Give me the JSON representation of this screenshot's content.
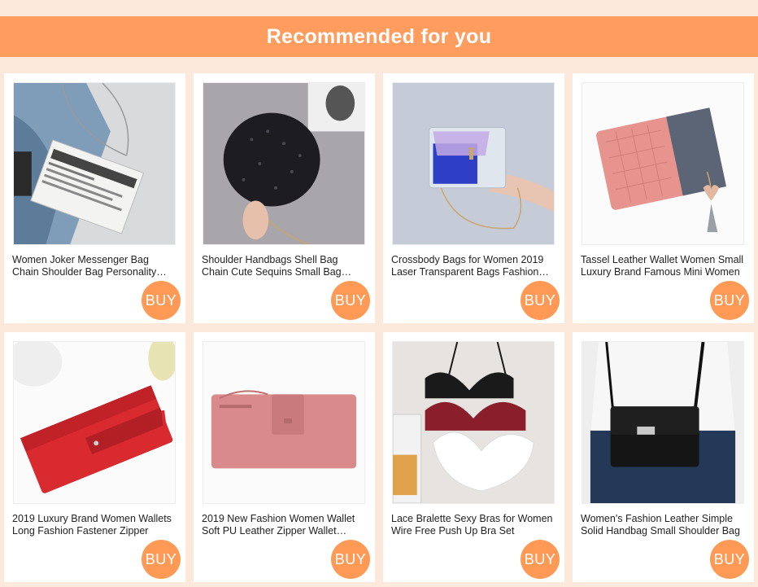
{
  "header": {
    "title": "Recommended for you"
  },
  "products": [
    {
      "title": "Women Joker Messenger Bag Chain Shoulder Bag Personality Letter Newspaper Clutch",
      "buy_label": "BUY",
      "image": "newspaper-chain-bag-image"
    },
    {
      "title": "Shoulder Handbags Shell Bag Chain Cute Sequins Small Bag Women",
      "buy_label": "BUY",
      "image": "black-sequin-shell-bag-image"
    },
    {
      "title": "Crossbody Bags for Women 2019 Laser Transparent Bags Fashion Women",
      "buy_label": "BUY",
      "image": "transparent-laser-crossbody-bag-image"
    },
    {
      "title": "Tassel Leather Wallet Women Small Luxury Brand Famous Mini Women",
      "buy_label": "BUY",
      "image": "pink-tassel-wallet-image"
    },
    {
      "title": "2019 Luxury Brand Women Wallets Long Fashion Fastener Zipper",
      "buy_label": "BUY",
      "image": "red-long-wallet-image"
    },
    {
      "title": "2019 New Fashion Women Wallet Soft PU Leather Zipper Wallet Women",
      "buy_label": "BUY",
      "image": "pink-zipper-wallet-image"
    },
    {
      "title": "Lace Bralette Sexy Bras for Women Wire Free Push Up Bra Set",
      "buy_label": "BUY",
      "image": "lace-bralette-image"
    },
    {
      "title": "Women's Fashion Leather Simple Solid Handbag Small Shoulder Bag",
      "buy_label": "BUY",
      "image": "black-leather-shoulder-bag-image"
    }
  ],
  "colors": {
    "background": "#fde9dc",
    "banner": "#ff9c5e",
    "buy_button": "#ff9a56"
  }
}
